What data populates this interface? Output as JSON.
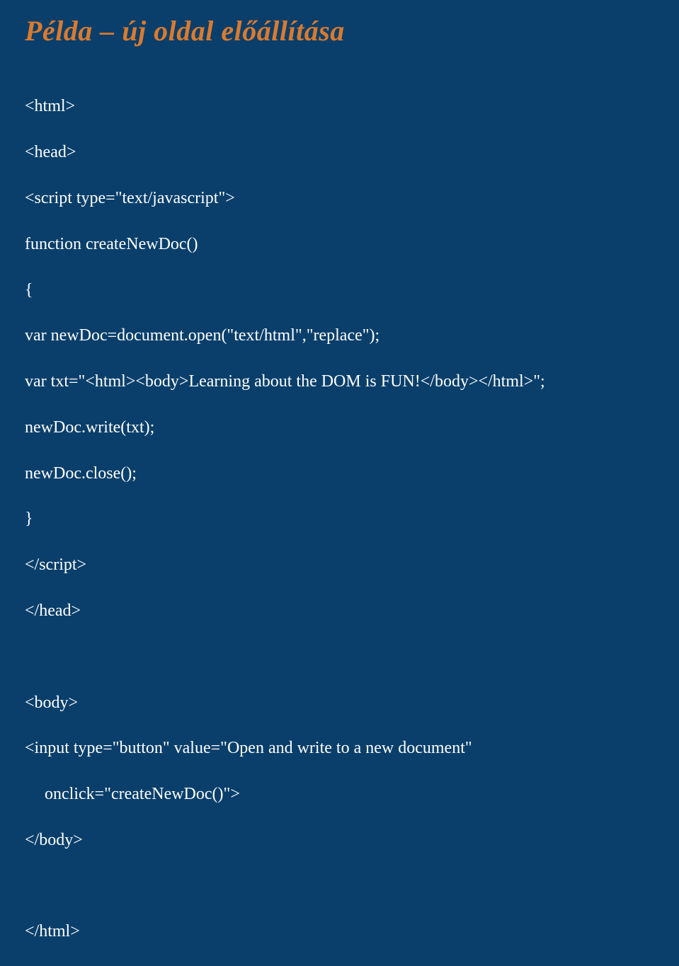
{
  "title": "Példa – új oldal előállítása",
  "code": {
    "l01": "<html>",
    "l02": "<head>",
    "l03": "<script type=\"text/javascript\">",
    "l04": "function createNewDoc()",
    "l05": "{",
    "l06": "var newDoc=document.open(\"text/html\",\"replace\");",
    "l07": "var txt=\"<html><body>Learning about the DOM is FUN!</body></html>\";",
    "l08": "newDoc.write(txt);",
    "l09": "newDoc.close();",
    "l10": "}",
    "l11": "</script>",
    "l12": "</head>",
    "l13": "",
    "l14": "<body>",
    "l15": "<input type=\"button\" value=\"Open and write to a new document\"",
    "l16": "onclick=\"createNewDoc()\">",
    "l17": "</body>",
    "l18": "",
    "l19": "</html>"
  }
}
